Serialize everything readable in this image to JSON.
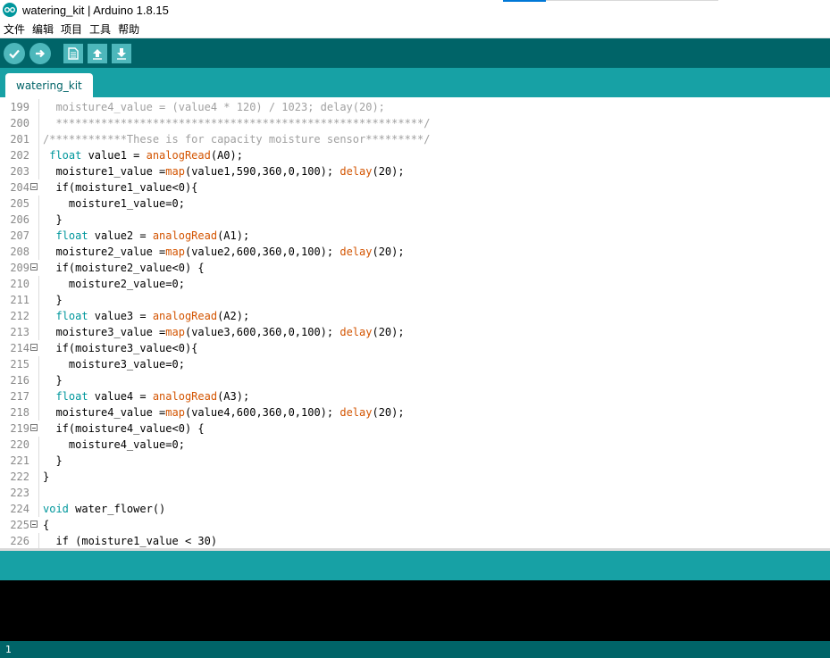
{
  "window": {
    "title": "watering_kit | Arduino 1.8.15",
    "logo_icon": "arduino-infinity-icon"
  },
  "menu": [
    "文件",
    "编辑",
    "项目",
    "工具",
    "帮助"
  ],
  "toolbar": {
    "buttons": [
      "verify-icon",
      "upload-arrow-icon",
      "new-file-icon",
      "open-up-arrow-icon",
      "save-down-arrow-icon"
    ]
  },
  "tabs": [
    {
      "label": "watering_kit",
      "active": true
    }
  ],
  "editor": {
    "lines": [
      {
        "num": "199",
        "fold": false,
        "tokens": [
          {
            "t": "  moisture4_value = (value4 * 120) / 1023; delay(20);",
            "c": "dim"
          }
        ]
      },
      {
        "num": "200",
        "fold": false,
        "tokens": [
          {
            "t": "  *********************************************************/",
            "c": "dim"
          }
        ]
      },
      {
        "num": "201",
        "fold": false,
        "tokens": [
          {
            "t": "/************These is for capacity moisture sensor*********/",
            "c": "dim"
          }
        ]
      },
      {
        "num": "202",
        "fold": false,
        "tokens": [
          {
            "t": " ",
            "c": ""
          },
          {
            "t": "float",
            "c": "kw"
          },
          {
            "t": " value1 = ",
            "c": ""
          },
          {
            "t": "analogRead",
            "c": "fn"
          },
          {
            "t": "(A0);",
            "c": ""
          }
        ]
      },
      {
        "num": "203",
        "fold": false,
        "tokens": [
          {
            "t": "  moisture1_value =",
            "c": ""
          },
          {
            "t": "map",
            "c": "fn"
          },
          {
            "t": "(value1,590,360,0,100); ",
            "c": ""
          },
          {
            "t": "delay",
            "c": "fn"
          },
          {
            "t": "(20);",
            "c": ""
          }
        ]
      },
      {
        "num": "204",
        "fold": true,
        "tokens": [
          {
            "t": "  if(moisture1_value<0){",
            "c": ""
          }
        ]
      },
      {
        "num": "205",
        "fold": false,
        "tokens": [
          {
            "t": "    moisture1_value=0;",
            "c": ""
          }
        ]
      },
      {
        "num": "206",
        "fold": false,
        "tokens": [
          {
            "t": "  }",
            "c": ""
          }
        ]
      },
      {
        "num": "207",
        "fold": false,
        "tokens": [
          {
            "t": "  ",
            "c": ""
          },
          {
            "t": "float",
            "c": "kw"
          },
          {
            "t": " value2 = ",
            "c": ""
          },
          {
            "t": "analogRead",
            "c": "fn"
          },
          {
            "t": "(A1);",
            "c": ""
          }
        ]
      },
      {
        "num": "208",
        "fold": false,
        "tokens": [
          {
            "t": "  moisture2_value =",
            "c": ""
          },
          {
            "t": "map",
            "c": "fn"
          },
          {
            "t": "(value2,600,360,0,100); ",
            "c": ""
          },
          {
            "t": "delay",
            "c": "fn"
          },
          {
            "t": "(20);",
            "c": ""
          }
        ]
      },
      {
        "num": "209",
        "fold": true,
        "tokens": [
          {
            "t": "  if(moisture2_value<0) {",
            "c": ""
          }
        ]
      },
      {
        "num": "210",
        "fold": false,
        "tokens": [
          {
            "t": "    moisture2_value=0;",
            "c": ""
          }
        ]
      },
      {
        "num": "211",
        "fold": false,
        "tokens": [
          {
            "t": "  }",
            "c": ""
          }
        ]
      },
      {
        "num": "212",
        "fold": false,
        "tokens": [
          {
            "t": "  ",
            "c": ""
          },
          {
            "t": "float",
            "c": "kw"
          },
          {
            "t": " value3 = ",
            "c": ""
          },
          {
            "t": "analogRead",
            "c": "fn"
          },
          {
            "t": "(A2);",
            "c": ""
          }
        ]
      },
      {
        "num": "213",
        "fold": false,
        "tokens": [
          {
            "t": "  moisture3_value =",
            "c": ""
          },
          {
            "t": "map",
            "c": "fn"
          },
          {
            "t": "(value3,600,360,0,100); ",
            "c": ""
          },
          {
            "t": "delay",
            "c": "fn"
          },
          {
            "t": "(20);",
            "c": ""
          }
        ]
      },
      {
        "num": "214",
        "fold": true,
        "tokens": [
          {
            "t": "  if(moisture3_value<0){",
            "c": ""
          }
        ]
      },
      {
        "num": "215",
        "fold": false,
        "tokens": [
          {
            "t": "    moisture3_value=0;",
            "c": ""
          }
        ]
      },
      {
        "num": "216",
        "fold": false,
        "tokens": [
          {
            "t": "  }",
            "c": ""
          }
        ]
      },
      {
        "num": "217",
        "fold": false,
        "tokens": [
          {
            "t": "  ",
            "c": ""
          },
          {
            "t": "float",
            "c": "kw"
          },
          {
            "t": " value4 = ",
            "c": ""
          },
          {
            "t": "analogRead",
            "c": "fn"
          },
          {
            "t": "(A3);",
            "c": ""
          }
        ]
      },
      {
        "num": "218",
        "fold": false,
        "tokens": [
          {
            "t": "  moisture4_value =",
            "c": ""
          },
          {
            "t": "map",
            "c": "fn"
          },
          {
            "t": "(value4,600,360,0,100); ",
            "c": ""
          },
          {
            "t": "delay",
            "c": "fn"
          },
          {
            "t": "(20);",
            "c": ""
          }
        ]
      },
      {
        "num": "219",
        "fold": true,
        "tokens": [
          {
            "t": "  if(moisture4_value<0) {",
            "c": ""
          }
        ]
      },
      {
        "num": "220",
        "fold": false,
        "tokens": [
          {
            "t": "    moisture4_value=0;",
            "c": ""
          }
        ]
      },
      {
        "num": "221",
        "fold": false,
        "tokens": [
          {
            "t": "  }",
            "c": ""
          }
        ]
      },
      {
        "num": "222",
        "fold": false,
        "tokens": [
          {
            "t": "}",
            "c": ""
          }
        ]
      },
      {
        "num": "223",
        "fold": false,
        "tokens": [
          {
            "t": "",
            "c": ""
          }
        ]
      },
      {
        "num": "224",
        "fold": false,
        "tokens": [
          {
            "t": "void",
            "c": "kw"
          },
          {
            "t": " water_flower()",
            "c": ""
          }
        ]
      },
      {
        "num": "225",
        "fold": true,
        "tokens": [
          {
            "t": "{",
            "c": ""
          }
        ]
      },
      {
        "num": "226",
        "fold": false,
        "tokens": [
          {
            "t": "  if (moisture1_value < 30)",
            "c": ""
          }
        ]
      }
    ]
  },
  "status": {
    "line": "1"
  },
  "colors": {
    "toolbar": "#006468",
    "tabbar": "#17a1a5",
    "keyword": "#00979c",
    "function": "#d35400",
    "comment": "#a0a0a0",
    "console": "#000000"
  }
}
